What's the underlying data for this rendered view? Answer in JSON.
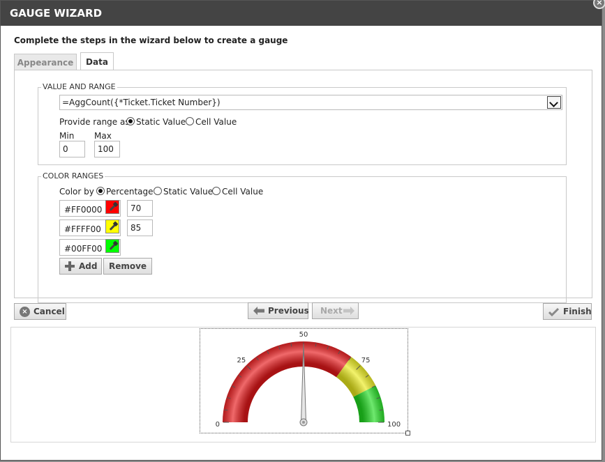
{
  "dialog": {
    "title": "GAUGE WIZARD",
    "close_glyph": "×",
    "subtitle": "Complete the steps in the wizard below to create a gauge"
  },
  "tabs": [
    {
      "label": "Appearance",
      "active": false
    },
    {
      "label": "Data",
      "active": true
    }
  ],
  "value_range": {
    "legend": "VALUE AND RANGE",
    "expression": "=AggCount({*Ticket.Ticket Number})",
    "range_label": "Provide range as",
    "range_options": [
      "Static Value",
      "Cell Value"
    ],
    "range_selected": "Static Value",
    "min_label": "Min",
    "max_label": "Max",
    "min_value": "0",
    "max_value": "100"
  },
  "color_ranges": {
    "legend": "COLOR RANGES",
    "color_by_label": "Color by",
    "color_by_options": [
      "Percentage",
      "Static Value",
      "Cell Value"
    ],
    "color_by_selected": "Percentage",
    "rows": [
      {
        "color": "#FF0000",
        "swatch": "#ff0000",
        "value": "70"
      },
      {
        "color": "#FFFF00",
        "swatch": "#ffff00",
        "value": "85"
      },
      {
        "color": "#00FF00",
        "swatch": "#00ff00",
        "value": ""
      }
    ],
    "add_label": "Add",
    "remove_label": "Remove"
  },
  "footer": {
    "cancel_label": "Cancel",
    "previous_label": "Previous",
    "next_label": "Next",
    "finish_label": "Finish"
  },
  "gauge": {
    "min": 0,
    "max": 100,
    "value": 50,
    "tick_labels": [
      "0",
      "25",
      "50",
      "75",
      "100"
    ],
    "ranges": [
      {
        "from": 0,
        "to": 70,
        "color": "#e8191b"
      },
      {
        "from": 70,
        "to": 85,
        "color": "#ecec1e"
      },
      {
        "from": 85,
        "to": 100,
        "color": "#22dd22"
      }
    ]
  }
}
